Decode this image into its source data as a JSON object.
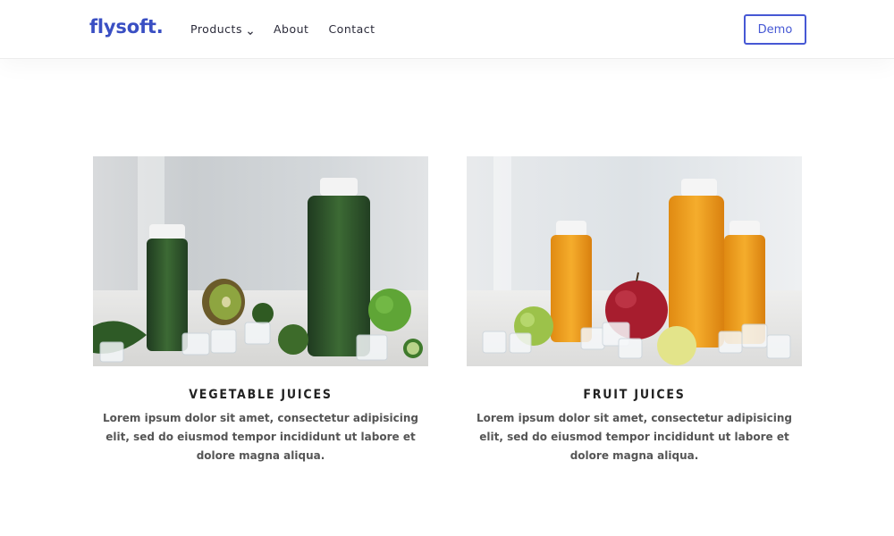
{
  "header": {
    "logo": "flysoft.",
    "nav": [
      {
        "label": "Products",
        "has_dropdown": true
      },
      {
        "label": "About",
        "has_dropdown": false
      },
      {
        "label": "Contact",
        "has_dropdown": false
      }
    ],
    "demo_label": "Demo"
  },
  "cards": [
    {
      "title": "VEGETABLE JUICES",
      "text": "Lorem ipsum dolor sit amet, consectetur adipisicing elit, sed do eiusmod tempor incididunt ut labore et dolore magna aliqua.",
      "image": "green-juice-bottles-photo"
    },
    {
      "title": "FRUIT JUICES",
      "text": "Lorem ipsum dolor sit amet, consectetur adipisicing elit, sed do eiusmod tempor incididunt ut labore et dolore magna aliqua.",
      "image": "orange-juice-bottles-photo"
    }
  ],
  "colors": {
    "brand": "#3a4fc3",
    "accent": "#4658d4",
    "text": "#555555",
    "heading": "#222222"
  }
}
